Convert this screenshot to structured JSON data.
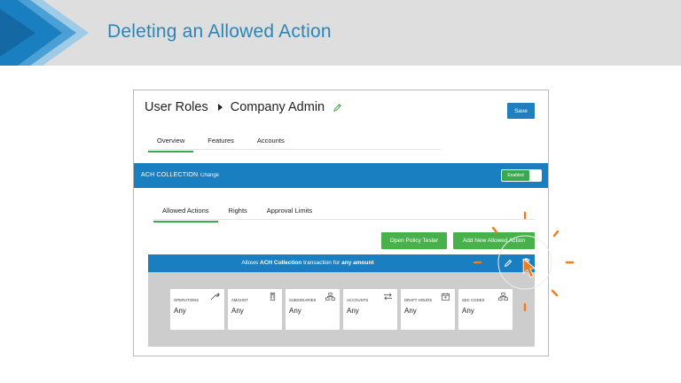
{
  "slide": {
    "title": "Deleting an Allowed Action",
    "colors": {
      "header_band": "#dedede",
      "chevron_dark": "#1a7fc0",
      "chevron_light": "#6fb3db",
      "title": "#2a86b8"
    }
  },
  "app": {
    "breadcrumb": {
      "root": "User Roles",
      "current": "Company Admin"
    },
    "save_label": "Save",
    "top_tabs": [
      {
        "label": "Overview",
        "active": true
      },
      {
        "label": "Features",
        "active": false
      },
      {
        "label": "Accounts",
        "active": false
      }
    ],
    "feature_bar": {
      "title": "ACH COLLECTION",
      "change_label": "Change",
      "toggle_label": "Enabled"
    },
    "sub_tabs": [
      {
        "label": "Allowed Actions",
        "active": true
      },
      {
        "label": "Rights",
        "active": false
      },
      {
        "label": "Approval Limits",
        "active": false
      }
    ],
    "buttons": {
      "policy_tester": "Open Policy Tester",
      "add_action": "Add New Allowed Action"
    },
    "allowed_action": {
      "prefix": "Allows",
      "feature": "ACH Collection",
      "middle": "transaction for",
      "amount": "any amount"
    },
    "cards": [
      {
        "label": "OPERATIONS",
        "value": "Any",
        "icon": "wrench-icon"
      },
      {
        "label": "AMOUNT",
        "value": "Any",
        "icon": "calculator-icon"
      },
      {
        "label": "SUBSIDIARIES",
        "value": "Any",
        "icon": "org-chart-icon"
      },
      {
        "label": "ACCOUNTS",
        "value": "Any",
        "icon": "transfer-arrows-icon"
      },
      {
        "label": "DRAFT HOURS",
        "value": "Any",
        "icon": "calendar-icon"
      },
      {
        "label": "SEC CODES",
        "value": "Any",
        "icon": "org-chart-icon"
      }
    ],
    "colors": {
      "primary": "#1a7fc0",
      "green": "#48b14c",
      "card_area": "#cdcdcd",
      "pointer": "#f07d1a"
    }
  }
}
